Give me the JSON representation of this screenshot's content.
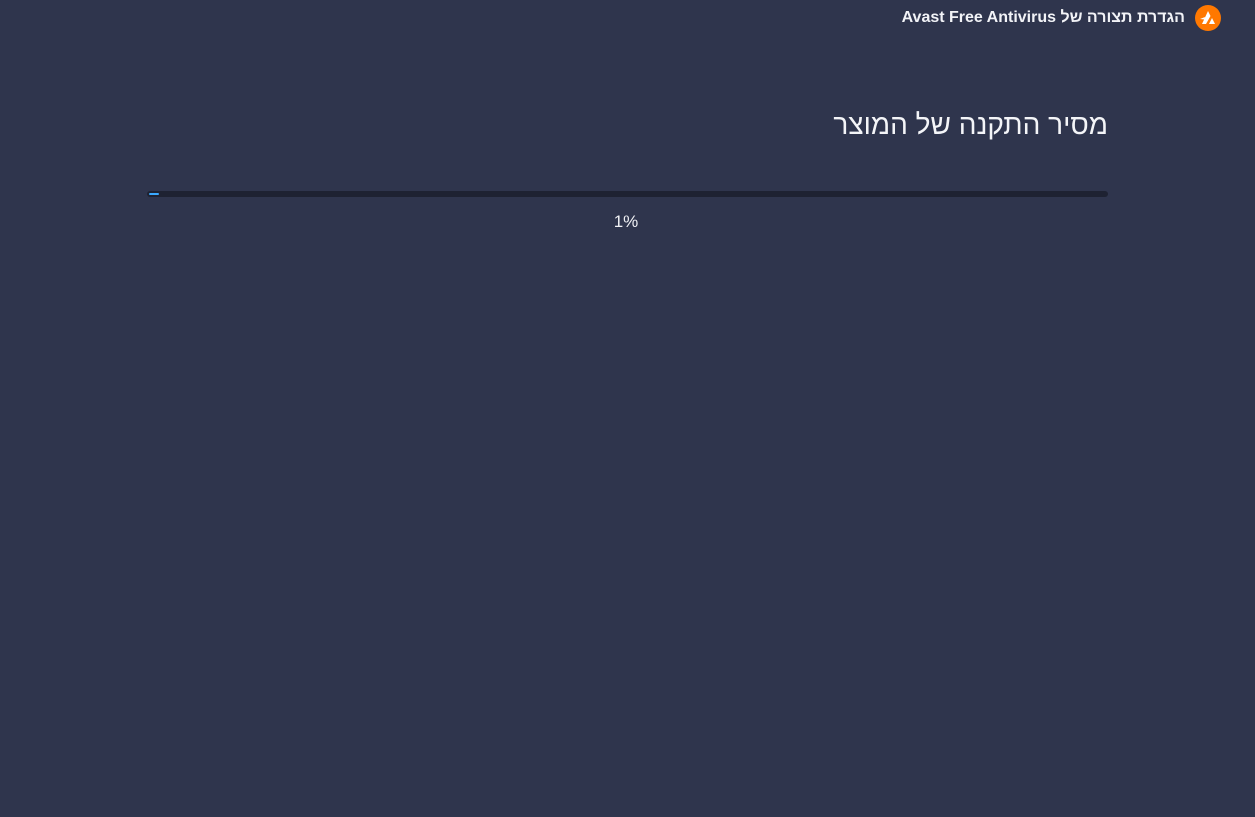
{
  "window": {
    "title": "הגדרת תצורה של Avast Free Antivirus",
    "logo_icon": "avast-logo-icon",
    "background_color": "#2f354d",
    "logo_color": "#ff7800"
  },
  "main": {
    "heading": "מסיר התקנה של המוצר",
    "progress": {
      "percent": 1,
      "label": "1%",
      "fill_color": "#3aa9ff",
      "track_color": "#1e2232"
    }
  }
}
